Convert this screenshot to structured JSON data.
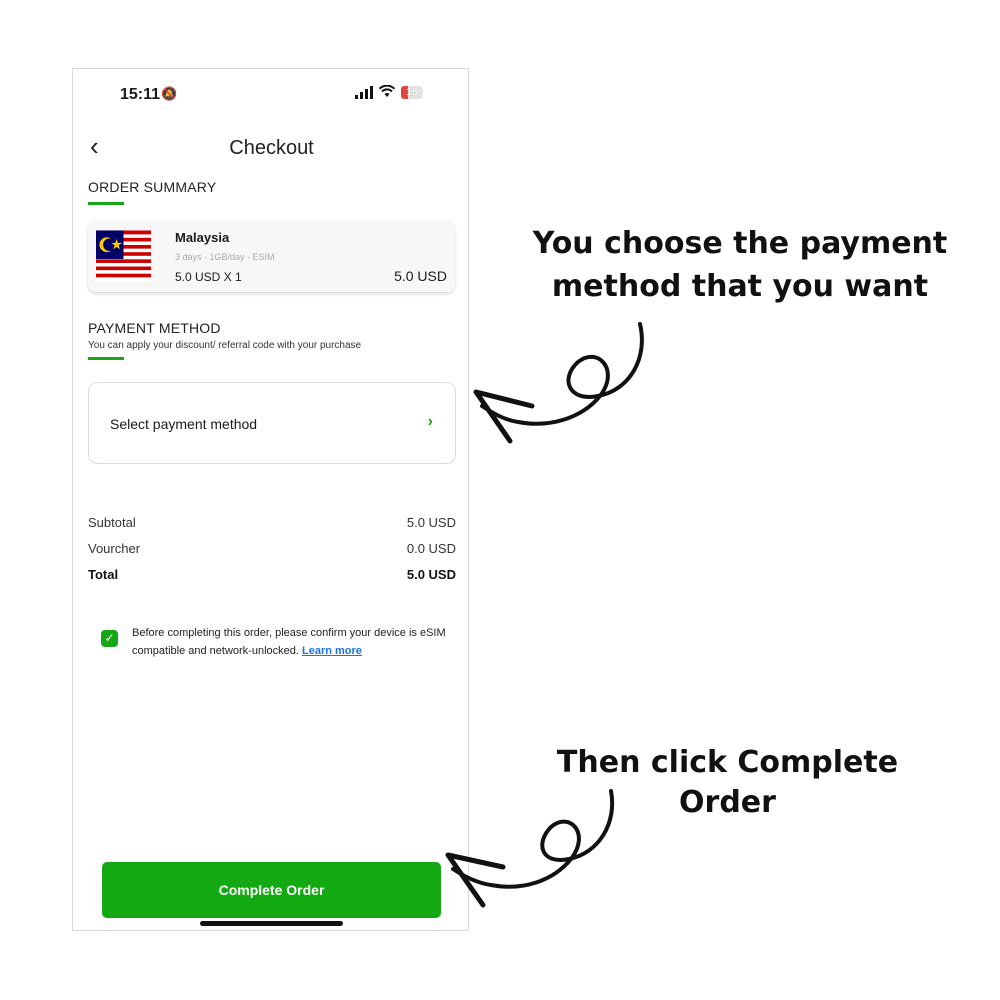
{
  "status_bar": {
    "time": "15:11",
    "battery": "18"
  },
  "header": {
    "title": "Checkout"
  },
  "order_summary": {
    "title": "ORDER SUMMARY",
    "item": {
      "name": "Malaysia",
      "description": "3 days - 1GB/day - ESIM",
      "quantity": "5.0 USD X 1",
      "price": "5.0 USD"
    }
  },
  "payment": {
    "title": "PAYMENT METHOD",
    "subtitle": "You can apply your discount/ referral code with your purchase",
    "select_label": "Select payment method"
  },
  "totals": {
    "subtotal_label": "Subtotal",
    "subtotal_value": "5.0 USD",
    "voucher_label": "Vourcher",
    "voucher_value": "0.0 USD",
    "total_label": "Total",
    "total_value": "5.0 USD"
  },
  "confirm": {
    "text": "Before completing this order, please confirm your device is eSIM compatible and network-unlocked.",
    "link": "Learn more",
    "checked": true
  },
  "complete_button": "Complete Order",
  "annotations": {
    "first_line1": "You choose the payment",
    "first_line2": "method that you want",
    "second": "Then click Complete Order"
  },
  "colors": {
    "accent": "#12a912",
    "link": "#1a73e8"
  }
}
